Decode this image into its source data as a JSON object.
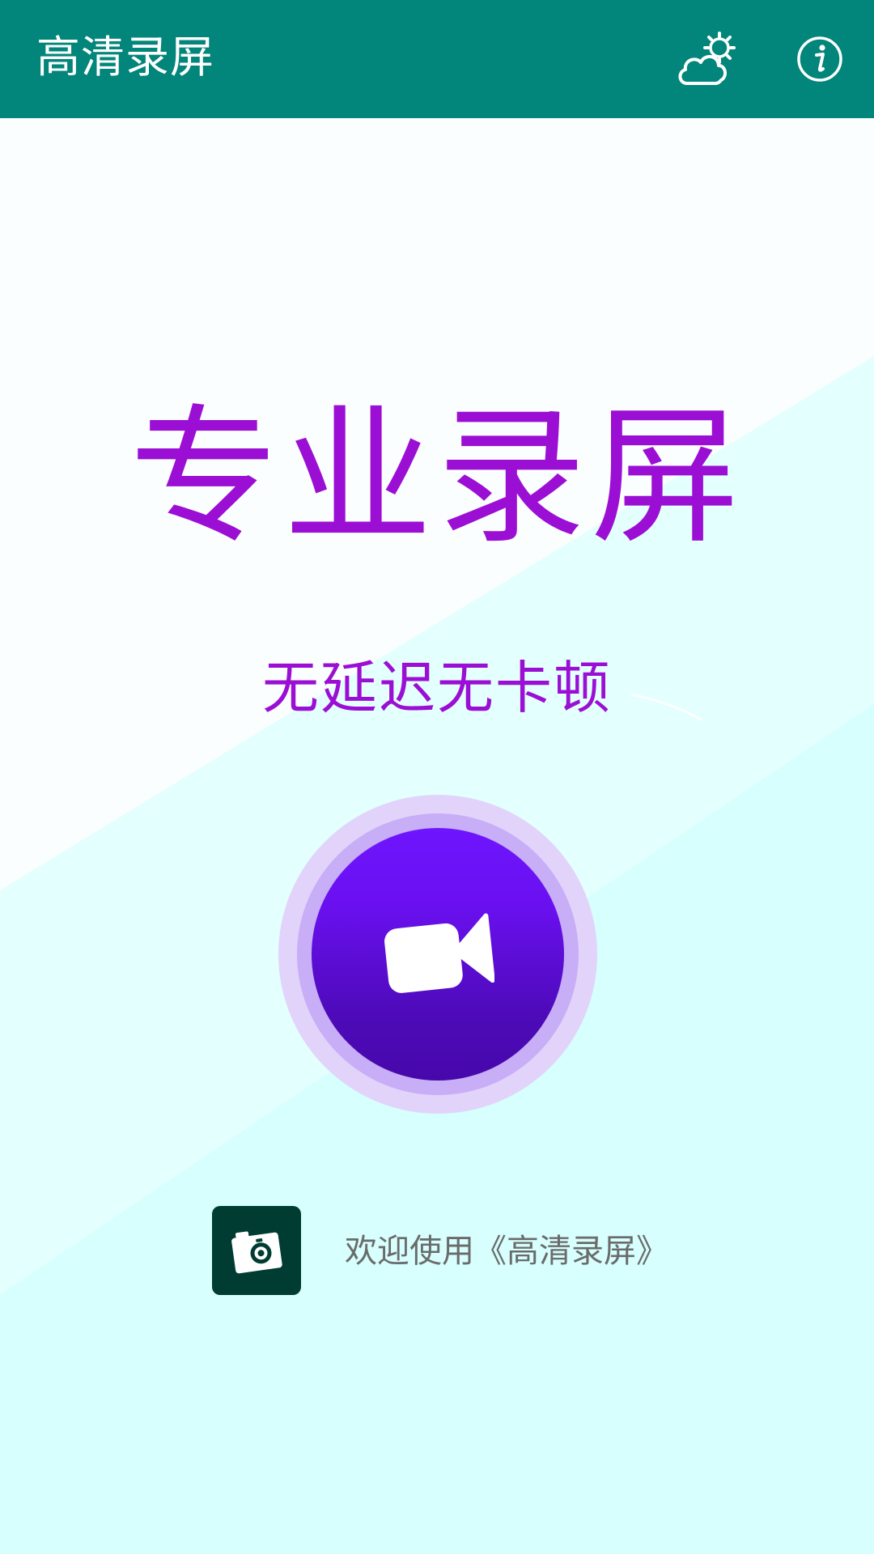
{
  "app": {
    "title": "高清录屏"
  },
  "header": {
    "weather_icon": "cloud-sun-icon",
    "info_icon": "info-icon"
  },
  "hero": {
    "headline": "专业录屏",
    "subline": "无延迟无卡顿"
  },
  "record_button": {
    "icon": "video-camera-icon"
  },
  "welcome": {
    "logo_icon": "camera-icon",
    "text": "欢迎使用《高清录屏》"
  },
  "colors": {
    "appbar": "#02857a",
    "headline": "#9b0fd4",
    "record_outer": "#e2d3fb",
    "record_ring": "#c7aef6",
    "record_top": "#6e15fe",
    "record_bottom": "#4608ab",
    "background_cyan": "#d6fffd",
    "logo_bg": "#003c32"
  }
}
